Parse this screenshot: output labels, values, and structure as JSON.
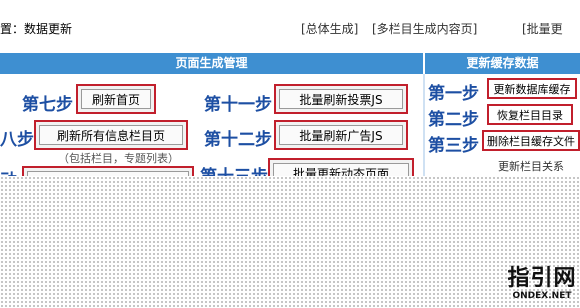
{
  "breadcrumb": "置：数据更新",
  "top_links": [
    "[总体生成]",
    "[多栏目生成内容页]",
    "[批量更"
  ],
  "header_left": "页面生成管理",
  "header_right": "更新缓存数据",
  "left_steps": [
    {
      "step": "第七步",
      "button": "刷新首页"
    },
    {
      "step": "八步",
      "button": "刷新所有信息栏目页"
    },
    {
      "step": "动",
      "button": ""
    }
  ],
  "left_note": "（包括栏目，专题列表）",
  "mid_steps": [
    {
      "step": "第十一步",
      "button": "批量刷新投票JS"
    },
    {
      "step": "第十二步",
      "button": "批量刷新广告JS"
    },
    {
      "step": "第十三步",
      "button": "批量更新动态页面"
    }
  ],
  "right_steps": [
    {
      "step": "第一步",
      "button": "更新数据库缓存"
    },
    {
      "step": "第二步",
      "button": "恢复栏目目录"
    },
    {
      "step": "第三步",
      "button": "删除栏目缓存文件"
    }
  ],
  "right_link": "更新栏目关系",
  "watermark": {
    "title": "指引网",
    "url": "ONDEX.NET"
  },
  "colors": {
    "header": "#3e8fd1",
    "step_text": "#1d4fa3",
    "button_border": "#c11f2c"
  }
}
